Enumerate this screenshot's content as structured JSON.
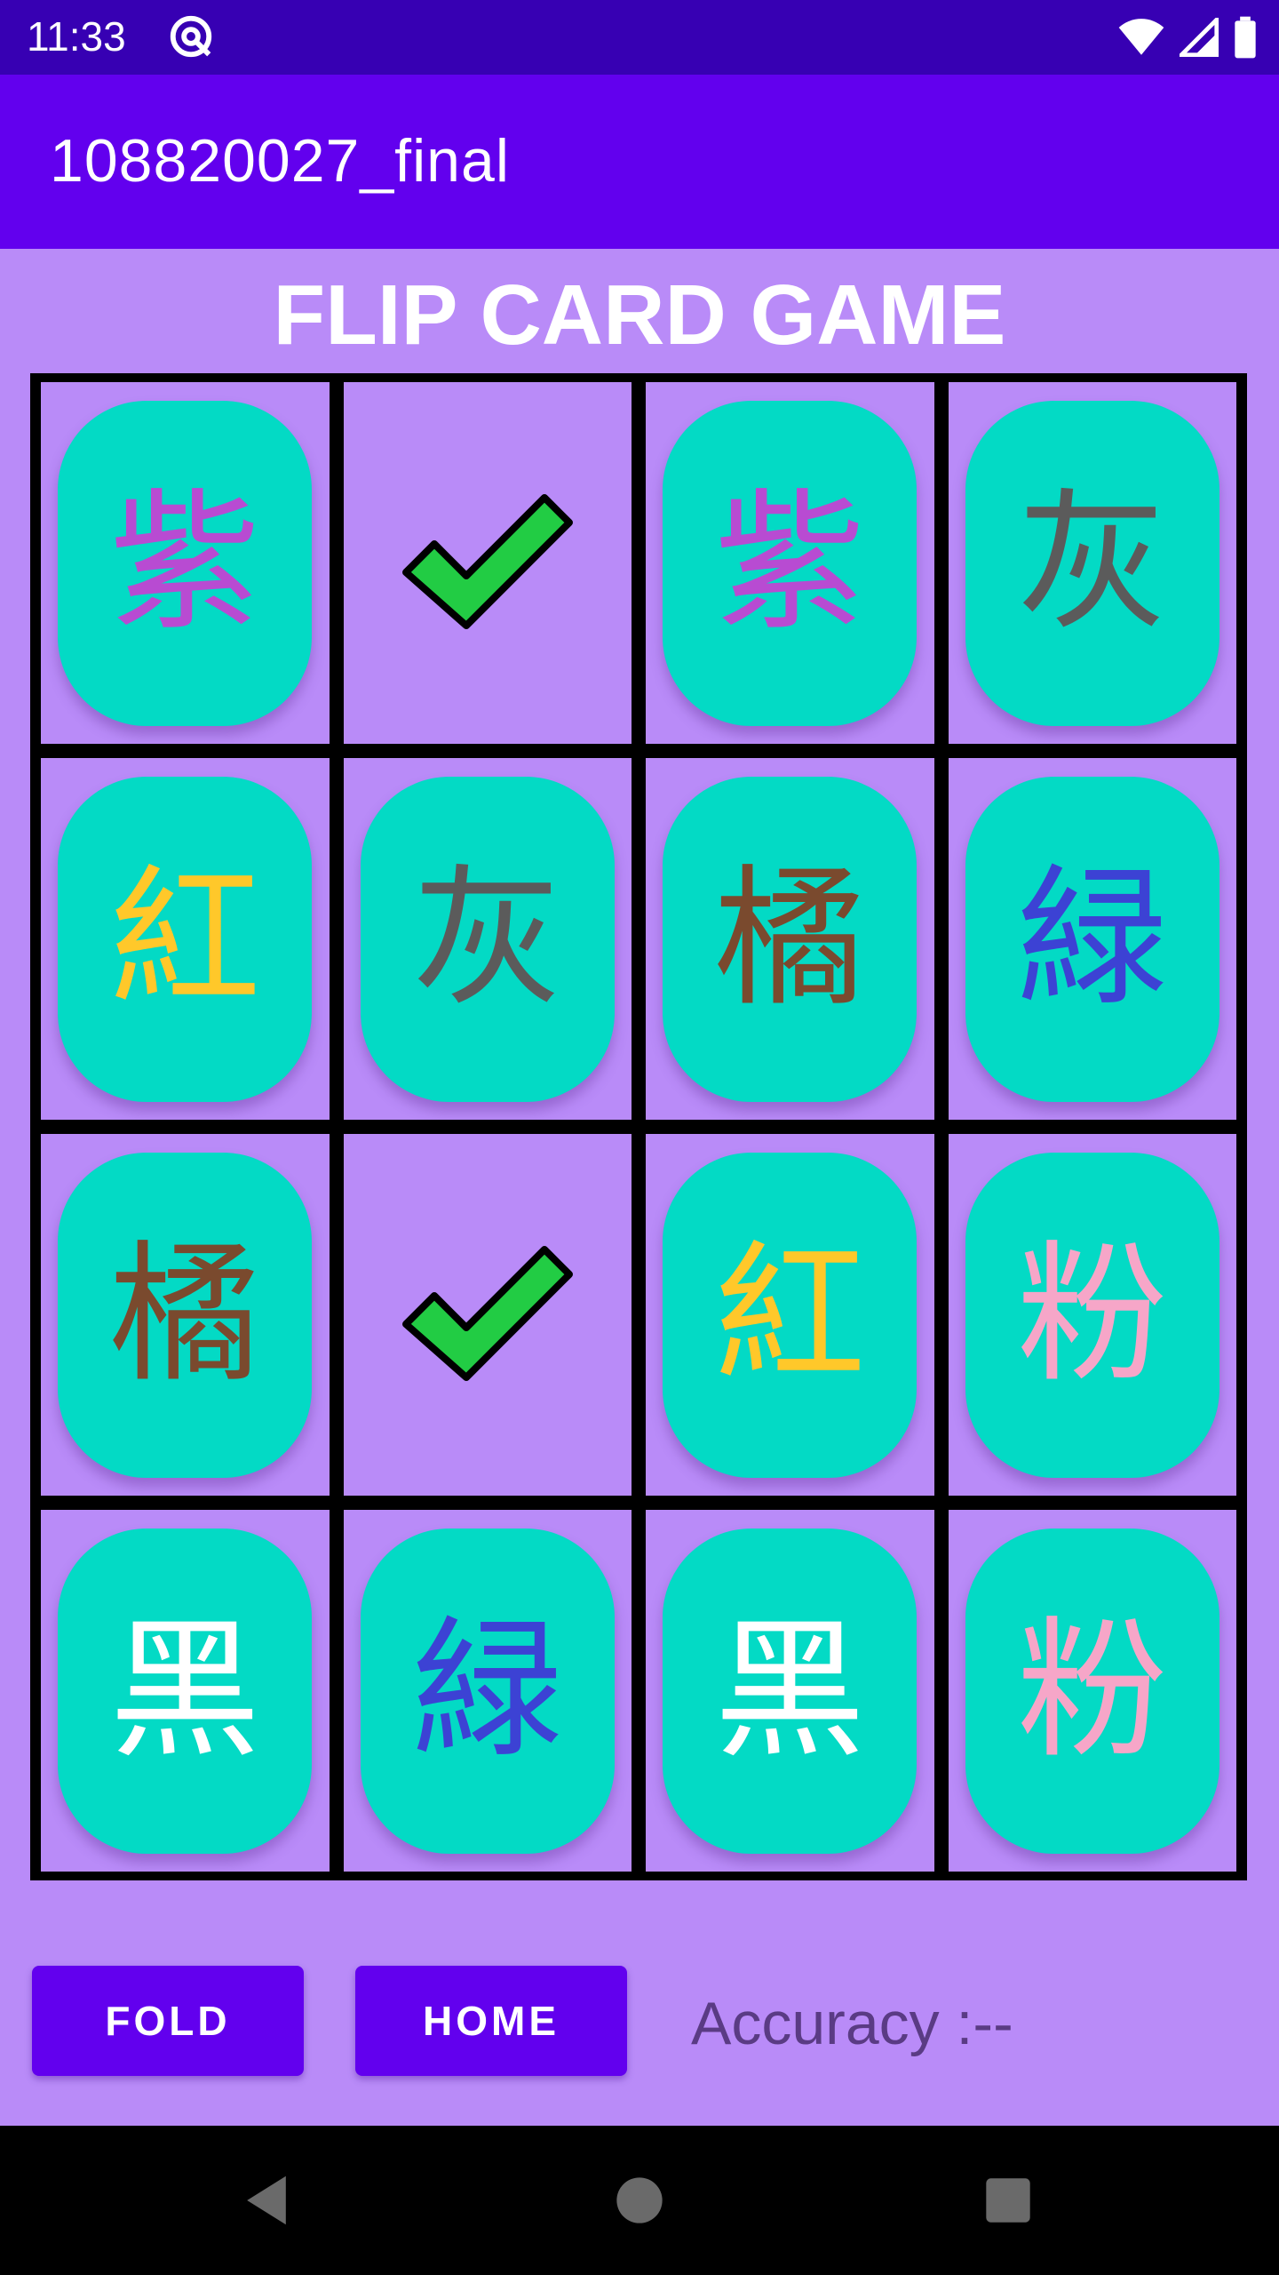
{
  "status_bar": {
    "time": "11:33"
  },
  "app_bar": {
    "title": "108820027_final"
  },
  "game": {
    "title": "FLIP CARD GAME",
    "cards": [
      {
        "char": "紫",
        "color": "#b84bd2",
        "matched": false
      },
      {
        "char": "",
        "color": "",
        "matched": true
      },
      {
        "char": "紫",
        "color": "#b84bd2",
        "matched": false
      },
      {
        "char": "灰",
        "color": "#5b5b5b",
        "matched": false
      },
      {
        "char": "紅",
        "color": "#ffc82a",
        "matched": false
      },
      {
        "char": "灰",
        "color": "#5b5b5b",
        "matched": false
      },
      {
        "char": "橘",
        "color": "#7a4a2e",
        "matched": false
      },
      {
        "char": "緑",
        "color": "#3c42d4",
        "matched": false
      },
      {
        "char": "橘",
        "color": "#7a4a2e",
        "matched": false
      },
      {
        "char": "",
        "color": "",
        "matched": true
      },
      {
        "char": "紅",
        "color": "#ffc82a",
        "matched": false
      },
      {
        "char": "粉",
        "color": "#f6a6c8",
        "matched": false
      },
      {
        "char": "黑",
        "color": "#ffffff",
        "matched": false
      },
      {
        "char": "緑",
        "color": "#3c42d4",
        "matched": false
      },
      {
        "char": "黑",
        "color": "#ffffff",
        "matched": false
      },
      {
        "char": "粉",
        "color": "#f6a6c8",
        "matched": false
      }
    ]
  },
  "controls": {
    "fold_label": "FOLD",
    "home_label": "HOME",
    "accuracy_text": "Accuracy :--"
  },
  "colors": {
    "status_bar": "#3700b3",
    "app_bar": "#6200ee",
    "background": "#b98bf8",
    "card": "#03dac5",
    "check": "#22cc44"
  }
}
